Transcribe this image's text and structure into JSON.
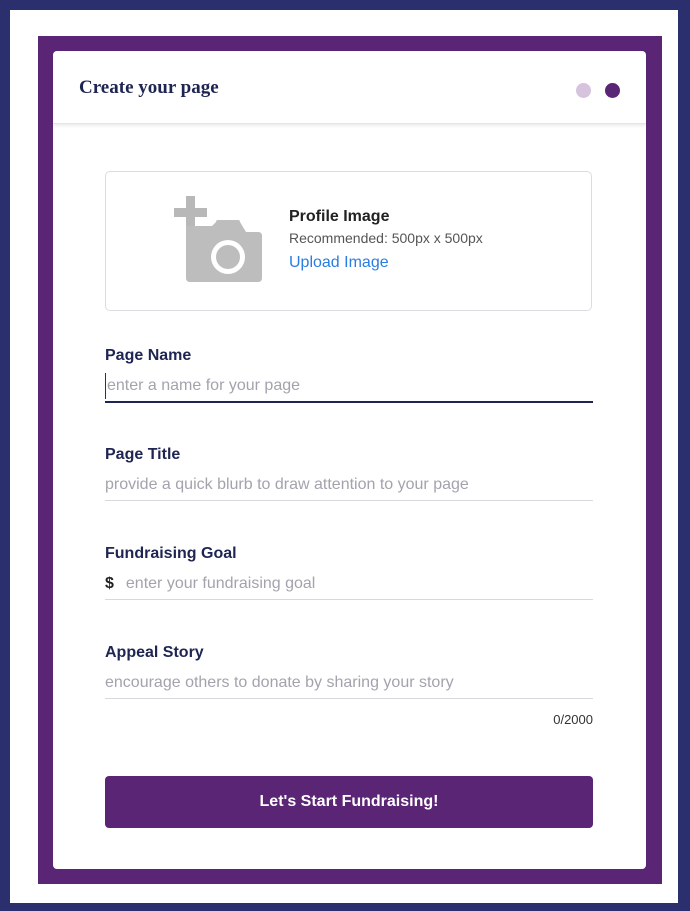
{
  "header": {
    "title": "Create your page",
    "steps": [
      "inactive",
      "active"
    ]
  },
  "profile_image": {
    "title": "Profile Image",
    "recommendation": "Recommended: 500px x 500px",
    "upload_label": "Upload Image",
    "icon": "camera-plus-icon"
  },
  "fields": {
    "page_name": {
      "label": "Page Name",
      "value": "",
      "placeholder": "enter a name for your page"
    },
    "page_title": {
      "label": "Page Title",
      "value": "",
      "placeholder": "provide a quick blurb to draw attention to your page"
    },
    "fundraising_goal": {
      "label": "Fundraising Goal",
      "currency": "$",
      "value": "",
      "placeholder": "enter your fundraising goal"
    },
    "appeal_story": {
      "label": "Appeal Story",
      "value": "",
      "placeholder": "encourage others to donate by sharing your story",
      "char_count": "0/2000"
    }
  },
  "submit_label": "Let's Start Fundraising!",
  "colors": {
    "brand_purple": "#5b2576",
    "navy": "#1f2552",
    "link_blue": "#2a7de1",
    "dot_inactive": "#d6c3dd",
    "page_border": "#2b2f6e"
  }
}
